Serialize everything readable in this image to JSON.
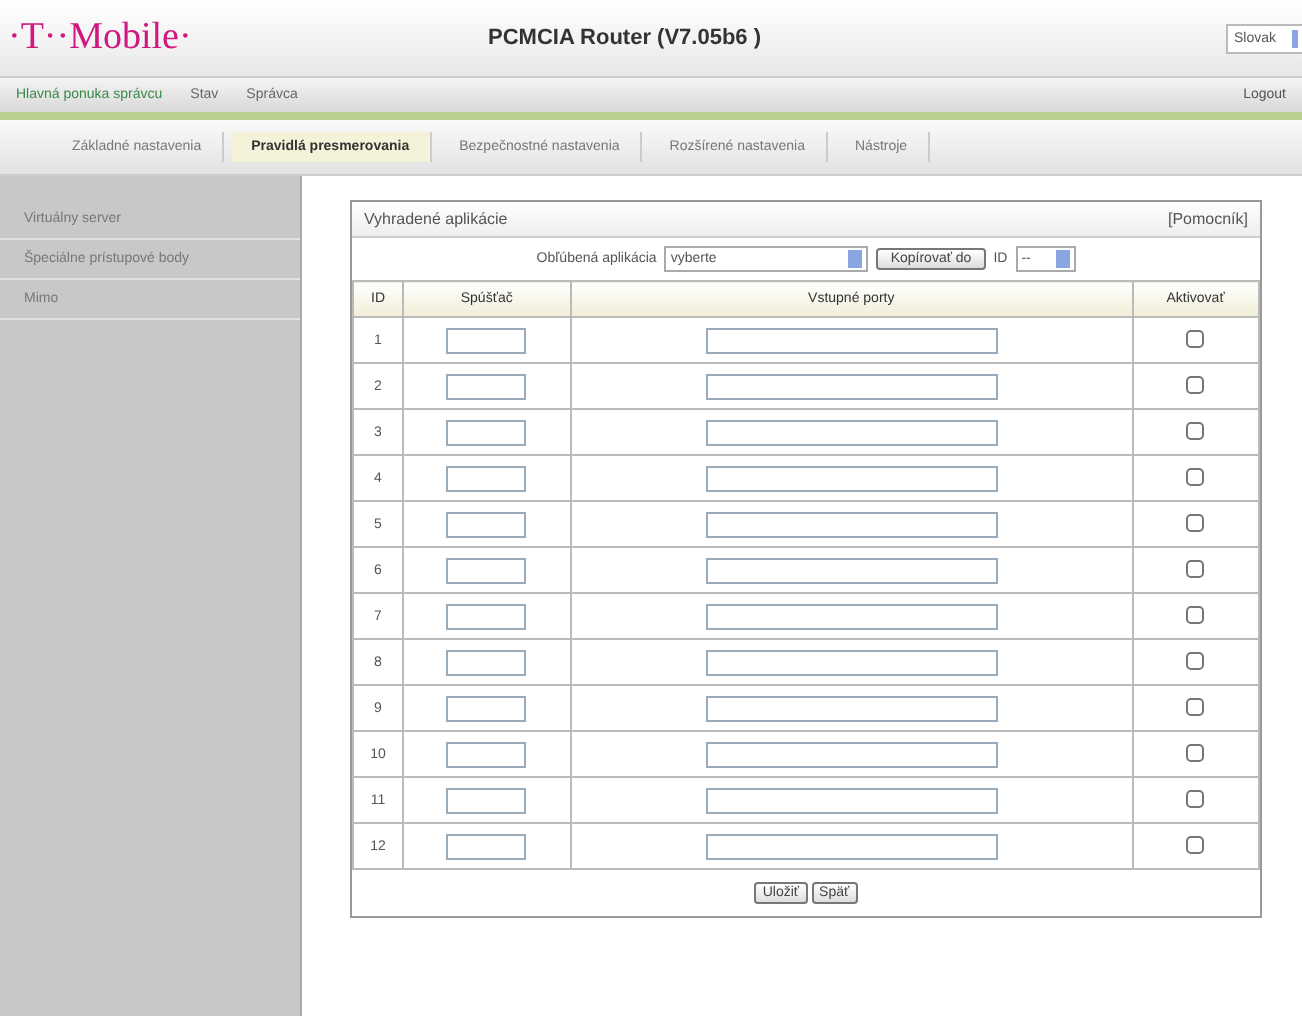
{
  "header": {
    "logo": "·T··Mobile·",
    "title": "PCMCIA Router (V7.05b6 )",
    "language": "Slovak"
  },
  "nav": {
    "items": [
      {
        "label": "Hlavná ponuka správcu",
        "selected": true
      },
      {
        "label": "Stav",
        "selected": false
      },
      {
        "label": "Správca",
        "selected": false
      }
    ],
    "logout": "Logout"
  },
  "tabs": [
    {
      "label": "Základné nastavenia",
      "selected": false
    },
    {
      "label": "Pravidlá presmerovania",
      "selected": true
    },
    {
      "label": "Bezpečnostné nastavenia",
      "selected": false
    },
    {
      "label": "Rozšírené nastavenia",
      "selected": false
    },
    {
      "label": "Nástroje",
      "selected": false
    }
  ],
  "sidebar": {
    "items": [
      {
        "label": "Virtuálny server"
      },
      {
        "label": "Špeciálne prístupové body"
      },
      {
        "label": "Mimo"
      }
    ]
  },
  "panel": {
    "title": "Vyhradené aplikácie",
    "help": "[Pomocník]",
    "favorite_label": "Obľúbená aplikácia",
    "favorite_value": "vyberte",
    "copy_button": "Kopírovať do",
    "id_prefix": "ID",
    "id_value": "--",
    "columns": [
      "ID",
      "Spúšťač",
      "Vstupné porty",
      "Aktivovať"
    ],
    "rows": [
      {
        "number": "1",
        "checked": false
      },
      {
        "number": "2",
        "checked": false
      },
      {
        "number": "3",
        "checked": false
      },
      {
        "number": "4",
        "checked": false
      },
      {
        "number": "5",
        "checked": false
      },
      {
        "number": "6",
        "checked": false
      },
      {
        "number": "7",
        "checked": false
      },
      {
        "number": "8",
        "checked": false
      },
      {
        "number": "9",
        "checked": false
      },
      {
        "number": "10",
        "checked": false
      },
      {
        "number": "11",
        "checked": false
      },
      {
        "number": "12",
        "checked": false
      }
    ],
    "buttons": [
      "Uložiť",
      "Späť"
    ]
  }
}
